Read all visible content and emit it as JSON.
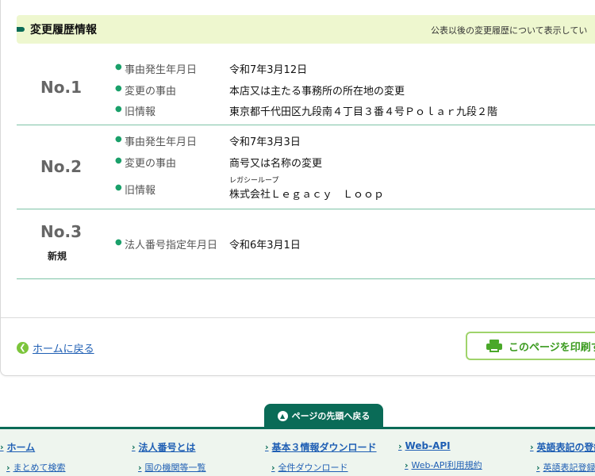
{
  "section": {
    "title": "変更履歴情報",
    "note": "公表以後の変更履歴について表示してい"
  },
  "records": [
    {
      "number": "No.1",
      "badge": "",
      "rows": [
        {
          "label": "事由発生年月日",
          "value": "令和7年3月12日"
        },
        {
          "label": "変更の事由",
          "value": "本店又は主たる事務所の所在地の変更"
        },
        {
          "label": "旧情報",
          "value": "東京都千代田区九段南４丁目３番４号Ｐｏｌａｒ九段２階"
        }
      ]
    },
    {
      "number": "No.2",
      "badge": "",
      "rows": [
        {
          "label": "事由発生年月日",
          "value": "令和7年3月3日"
        },
        {
          "label": "変更の事由",
          "value": "商号又は名称の変更"
        },
        {
          "label": "旧情報",
          "ruby": "レガシーループ",
          "value": "株式会社Ｌｅｇａｃｙ　Ｌｏｏｐ"
        }
      ]
    },
    {
      "number": "No.3",
      "badge": "新規",
      "rows": [
        {
          "label": "法人番号指定年月日",
          "value": "令和6年3月1日"
        }
      ]
    }
  ],
  "actions": {
    "back_label": "ホームに戻る",
    "print_label": "このページを印刷す"
  },
  "pagetop_label": "ページの先頭へ戻る",
  "footer": [
    {
      "title": "ホーム",
      "sub": "まとめて検索"
    },
    {
      "title": "法人番号とは",
      "sub": "国の機関等一覧"
    },
    {
      "title": "基本３情報ダウンロード",
      "sub": "全件ダウンロード"
    },
    {
      "title": "Web-API",
      "sub": "Web-API利用規約"
    },
    {
      "title": "英語表記の登録",
      "sub": "英語表記登録"
    }
  ],
  "colors": {
    "brand_green": "#0a6b57",
    "header_bg": "#eef7cf",
    "link_blue": "#1f5fb4",
    "accent_green": "#4aa82a"
  },
  "icons": {
    "back": "chevron-left-circle-icon",
    "print": "printer-icon",
    "pagetop": "chevron-up-circle-icon"
  }
}
